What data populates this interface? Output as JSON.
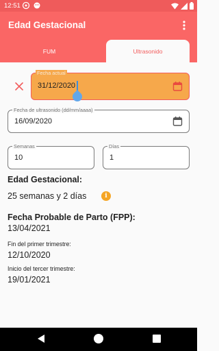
{
  "status_bar": {
    "time": "12:51"
  },
  "app_bar": {
    "title": "Edad Gestacional"
  },
  "tabs": [
    {
      "label": "FUM"
    },
    {
      "label": "Ultrasonido"
    }
  ],
  "form": {
    "fecha_actual": {
      "label": "Fecha actual",
      "value": "31/12/2020"
    },
    "fecha_ultrasonido": {
      "label": "Fecha de ultrasonido (dd/mm/aaaa)",
      "value": "16/09/2020"
    },
    "semanas": {
      "label": "Semanas",
      "value": "10"
    },
    "dias": {
      "label": "Días",
      "value": "1"
    }
  },
  "results": {
    "edad_title": "Edad Gestacional:",
    "edad_value": "25 semanas y 2 días",
    "fpp_title": "Fecha Probable de Parto (FPP):",
    "fpp_value": "13/04/2021",
    "fin_primer_label": "Fin del primer trimestre:",
    "fin_primer_value": "12/10/2020",
    "inicio_tercer_label": "Inicio del tercer trimestre:",
    "inicio_tercer_value": "19/01/2021"
  },
  "colors": {
    "primary": "#fa6665",
    "status": "#ef5b5b",
    "active_field": "#f6a84b",
    "info": "#f5a524",
    "cursor": "#3a8de0"
  },
  "icons": [
    "moon-icon",
    "more-vert-icon",
    "close-icon",
    "calendar-icon",
    "info-icon",
    "back-icon",
    "home-icon",
    "recents-icon"
  ]
}
